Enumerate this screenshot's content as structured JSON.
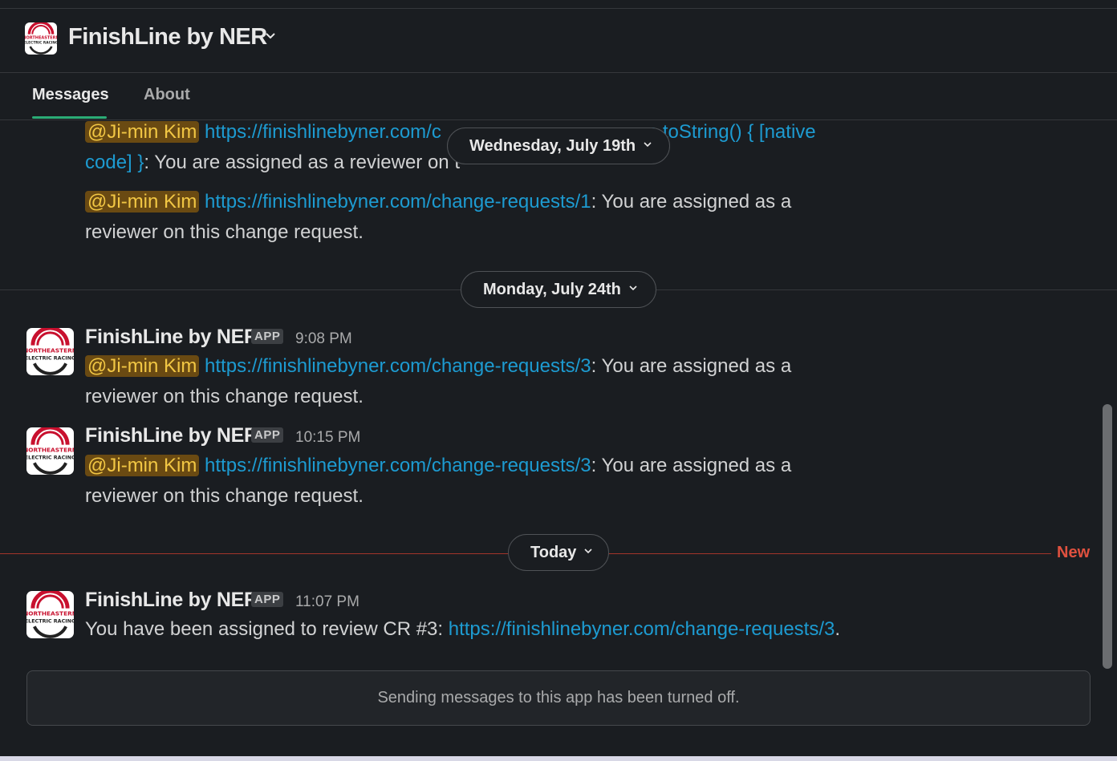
{
  "header": {
    "title": "FinishLine by NER"
  },
  "tabs": [
    {
      "label": "Messages"
    },
    {
      "label": "About"
    }
  ],
  "logo": {
    "line1": "NORTHEASTERN",
    "line2": "ELECTRIC RACING"
  },
  "top_messages": [
    {
      "mention": "@Ji-min Kim",
      "link": "https://finishlinebyner.com/change-requests/function toString() { [native code] }",
      "text": ": You are assigned as a reviewer on this change request."
    },
    {
      "mention": "@Ji-min Kim",
      "link": "https://finishlinebyner.com/change-requests/1",
      "text": ": You are assigned as a reviewer on this change request."
    }
  ],
  "link_fragments": {
    "first_a": "https://finishlinebyner.com/c",
    "first_b": "t",
    "first_c": "n toString() { [native",
    "first_d": "code] }",
    "first_text_visible": ": You are assigned as a reviewer on t"
  },
  "dates": [
    {
      "label": "Wednesday, July 19th"
    },
    {
      "label": "Monday, July 24th"
    },
    {
      "label": "Today"
    }
  ],
  "new_label": "New",
  "messages": [
    {
      "sender": "FinishLine by NER",
      "badge": "APP",
      "time": "9:08 PM",
      "mention": "@Ji-min Kim",
      "link": "https://finishlinebyner.com/change-requests/3",
      "text_line1": ": You are assigned as a",
      "text_line2": "reviewer on this change request."
    },
    {
      "sender": "FinishLine by NER",
      "badge": "APP",
      "time": "10:15 PM",
      "mention": "@Ji-min Kim",
      "link": "https://finishlinebyner.com/change-requests/3",
      "text_line1": ": You are assigned as a",
      "text_line2": "reviewer on this change request."
    },
    {
      "sender": "FinishLine by NER",
      "badge": "APP",
      "time": "11:07 PM",
      "prefix": "You have been assigned to review CR #3: ",
      "link": "https://finishlinebyner.com/change-requests/3",
      "suffix": "."
    }
  ],
  "composer": {
    "notice": "Sending messages to this app has been turned off."
  },
  "colors": {
    "background": "#1a1d21",
    "link": "#1d9bd1",
    "mention_bg": "#6a4a12",
    "mention_fg": "#f2c744",
    "new": "#e0513f",
    "tab_underline": "#2bac76"
  }
}
